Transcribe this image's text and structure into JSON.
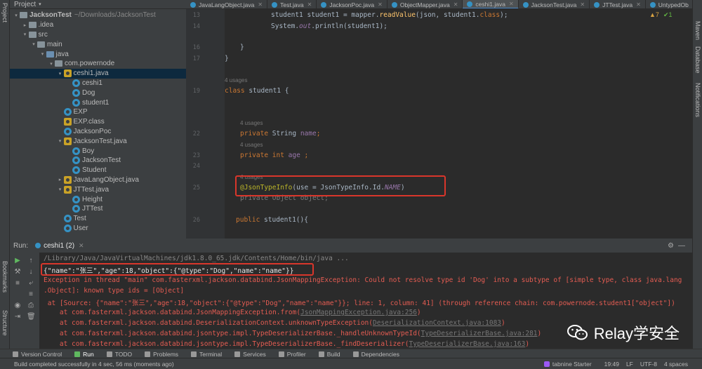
{
  "sidebar_left": {
    "project_label": "Project",
    "bookmarks_label": "Bookmarks",
    "structure_label": "Structure"
  },
  "sidebar_right": {
    "maven_label": "Maven",
    "database_label": "Database",
    "notifications_label": "Notifications"
  },
  "project_panel": {
    "header": "Project",
    "tree": [
      {
        "label": "JacksonTest",
        "suffix": "~/Downloads/JacksonTest",
        "type": "folder",
        "indent": 0,
        "arrow": "▾",
        "bold": true
      },
      {
        "label": ".idea",
        "type": "folder",
        "indent": 1,
        "arrow": "▸"
      },
      {
        "label": "src",
        "type": "folder",
        "indent": 1,
        "arrow": "▾"
      },
      {
        "label": "main",
        "type": "folder",
        "indent": 2,
        "arrow": "▾"
      },
      {
        "label": "java",
        "type": "src",
        "indent": 3,
        "arrow": "▾"
      },
      {
        "label": "com.powernode",
        "type": "folder",
        "indent": 4,
        "arrow": "▾"
      },
      {
        "label": "ceshi1.java",
        "type": "java",
        "indent": 5,
        "arrow": "▾",
        "selected": true
      },
      {
        "label": "ceshi1",
        "type": "cls",
        "indent": 6,
        "arrow": ""
      },
      {
        "label": "Dog",
        "type": "cls",
        "indent": 6,
        "arrow": ""
      },
      {
        "label": "student1",
        "type": "cls",
        "indent": 6,
        "arrow": ""
      },
      {
        "label": "EXP",
        "type": "cls",
        "indent": 5,
        "arrow": ""
      },
      {
        "label": "EXP.class",
        "type": "java",
        "indent": 5,
        "arrow": ""
      },
      {
        "label": "JacksonPoc",
        "type": "cls",
        "indent": 5,
        "arrow": ""
      },
      {
        "label": "JacksonTest.java",
        "type": "java",
        "indent": 5,
        "arrow": "▾"
      },
      {
        "label": "Boy",
        "type": "cls",
        "indent": 6,
        "arrow": ""
      },
      {
        "label": "JacksonTest",
        "type": "cls",
        "indent": 6,
        "arrow": ""
      },
      {
        "label": "Student",
        "type": "cls",
        "indent": 6,
        "arrow": ""
      },
      {
        "label": "JavaLangObject.java",
        "type": "java",
        "indent": 5,
        "arrow": "▸"
      },
      {
        "label": "JTTest.java",
        "type": "java",
        "indent": 5,
        "arrow": "▾"
      },
      {
        "label": "Height",
        "type": "cls",
        "indent": 6,
        "arrow": ""
      },
      {
        "label": "JTTest",
        "type": "cls",
        "indent": 6,
        "arrow": ""
      },
      {
        "label": "Test",
        "type": "cls",
        "indent": 5,
        "arrow": ""
      },
      {
        "label": "User",
        "type": "cls",
        "indent": 5,
        "arrow": ""
      }
    ]
  },
  "editor_tabs": [
    {
      "label": "JavaLangObject.java"
    },
    {
      "label": "Test.java"
    },
    {
      "label": "JacksonPoc.java"
    },
    {
      "label": "ObjectMapper.java"
    },
    {
      "label": "ceshi1.java",
      "active": true
    },
    {
      "label": "JacksonTest.java"
    },
    {
      "label": "JTTest.java"
    },
    {
      "label": "UntypedOb"
    }
  ],
  "inspection": {
    "warnings": "▲7",
    "checks": "✔1"
  },
  "code": {
    "line_numbers": [
      "13",
      "14",
      "",
      "16",
      "17",
      "",
      "19",
      "",
      "",
      "22",
      "",
      "23",
      "24",
      "",
      "25",
      "",
      "26",
      ""
    ],
    "usage_4": "4 usages",
    "lines": {
      "l13_a": "student1 student1 = mapper.",
      "l13_fn": "readValue",
      "l13_b": "(json, student1.",
      "l13_kw": "class",
      "l13_c": ");",
      "l14_a": "System.",
      "l14_out": "out",
      "l14_b": ".println(student1);",
      "l16": "}",
      "l17": "}",
      "l19_kw": "class",
      "l19_b": " student1 {",
      "l22_kw": "private",
      "l22_b": " String ",
      "l22_field": "name",
      "l22_c": ";",
      "l23_kw1": "private",
      "l23_kw2": " int",
      "l23_field": " age",
      "l23_c": " ;",
      "l25_ann": "@JsonTypeInfo",
      "l25_b": "(use = JsonTypeInfo.Id.",
      "l25_it": "NAME",
      "l25_c": ")",
      "l25b": "private Object object;",
      "l26_kw": "public",
      "l26_b": " student1(){"
    }
  },
  "run_panel": {
    "label": "Run:",
    "tab_label": "ceshi1 (2)",
    "output": {
      "cmd": "/Library/Java/JavaVirtualMachines/jdk1.8.0_65.jdk/Contents/Home/bin/java ...",
      "json": "{\"name\":\"张三\",\"age\":18,\"object\":{\"@type\":\"Dog\",\"name\":\"name\"}}",
      "ex1": "Exception in thread \"main\" com.fasterxml.jackson.databind.JsonMappingException: Could not resolve type id 'Dog' into a subtype of [simple type, class java.lang",
      "ex2": ".Object]: known type ids = [Object]",
      "ex3": " at [Source: {\"name\":\"张三\",\"age\":18,\"object\":{\"@type\":\"Dog\",\"name\":\"name\"}}; line: 1, column: 41] (through reference chain: com.powernode.student1[\"object\"])",
      "st1_a": "    at com.fasterxml.jackson.databind.JsonMappingException.from(",
      "st1_link": "JsonMappingException.java:256",
      "st2_a": "    at com.fasterxml.jackson.databind.DeserializationContext.unknownTypeException(",
      "st2_link": "DeserializationContext.java:1083",
      "st3_a": "    at com.fasterxml.jackson.databind.jsontype.impl.TypeDeserializerBase._handleUnknownTypeId(",
      "st3_link": "TypeDeserializerBase.java:281",
      "st4_a": "    at com.fasterxml.jackson.databind.jsontype.impl.TypeDeserializerBase._findDeserializer(",
      "st4_link": "TypeDeserializerBase.java:163",
      "close": ")"
    }
  },
  "bottom_tabs": [
    {
      "label": "Version Control"
    },
    {
      "label": "Run",
      "active": true
    },
    {
      "label": "TODO"
    },
    {
      "label": "Problems"
    },
    {
      "label": "Terminal"
    },
    {
      "label": "Services"
    },
    {
      "label": "Profiler"
    },
    {
      "label": "Build"
    },
    {
      "label": "Dependencies"
    }
  ],
  "status_bar": {
    "message": "Build completed successfully in 4 sec, 56 ms (moments ago)",
    "tabnine": "tabnine Starter",
    "position": "19:49",
    "line_sep": "LF",
    "encoding": "UTF-8",
    "indent": "4 spaces"
  },
  "watermark": {
    "text": "Relay学安全"
  }
}
